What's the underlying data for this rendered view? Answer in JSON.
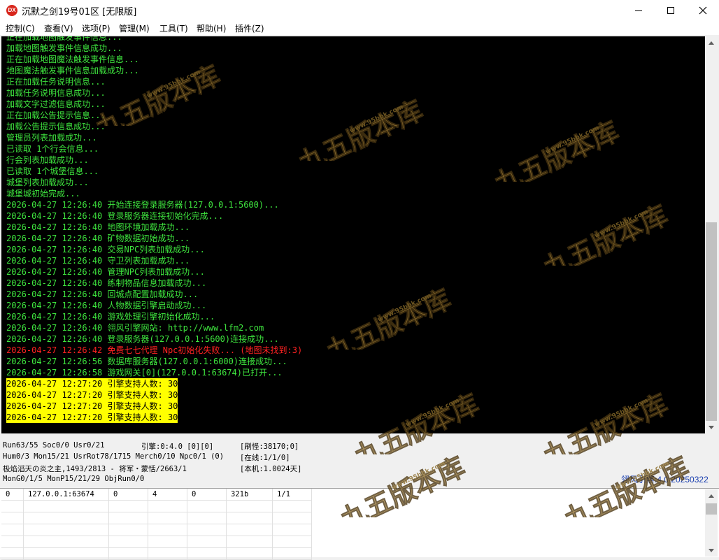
{
  "window": {
    "icon_text": "DX",
    "title": "沉默之剑19号01区 [无限版]"
  },
  "menu": [
    "控制(C)",
    "查看(V)",
    "选项(P)",
    "管理(M)",
    "工具(T)",
    "帮助(H)",
    "插件(Z)"
  ],
  "console_lines": [
    {
      "text": "正在加载地图触发事件信息...",
      "style": "g"
    },
    {
      "text": "加载地图触发事件信息成功...",
      "style": "g"
    },
    {
      "text": "正在加载地图魔法触发事件信息...",
      "style": "g"
    },
    {
      "text": "地图魔法触发事件信息加载成功...",
      "style": "g"
    },
    {
      "text": "正在加载任务说明信息...",
      "style": "g"
    },
    {
      "text": "加载任务说明信息成功...",
      "style": "g"
    },
    {
      "text": "加载文字过滤信息成功...",
      "style": "g"
    },
    {
      "text": "正在加载公告提示信息...",
      "style": "g"
    },
    {
      "text": "加载公告提示信息成功...",
      "style": "g"
    },
    {
      "text": "管理员列表加载成功...",
      "style": "g"
    },
    {
      "text": "已读取 1个行会信息...",
      "style": "g"
    },
    {
      "text": "行会列表加载成功...",
      "style": "g"
    },
    {
      "text": "已读取 1个城堡信息...",
      "style": "g"
    },
    {
      "text": "城堡列表加载成功...",
      "style": "g"
    },
    {
      "text": "城堡城初始完成...",
      "style": "g"
    },
    {
      "text": "2026-04-27 12:26:40 开始连接登录服务器(127.0.0.1:5600)...",
      "style": "g"
    },
    {
      "text": "2026-04-27 12:26:40 登录服务器连接初始化完成...",
      "style": "g"
    },
    {
      "text": "2026-04-27 12:26:40 地图环境加载成功...",
      "style": "g"
    },
    {
      "text": "2026-04-27 12:26:40 矿物数据初始成功...",
      "style": "g"
    },
    {
      "text": "2026-04-27 12:26:40 交易NPC列表加载成功...",
      "style": "g"
    },
    {
      "text": "2026-04-27 12:26:40 守卫列表加载成功...",
      "style": "g"
    },
    {
      "text": "2026-04-27 12:26:40 管理NPC列表加载成功...",
      "style": "g"
    },
    {
      "text": "2026-04-27 12:26:40 练制物品信息加载成功...",
      "style": "g"
    },
    {
      "text": "2026-04-27 12:26:40 回城点配置加载成功...",
      "style": "g"
    },
    {
      "text": "2026-04-27 12:26:40 人物数据引擎启动成功...",
      "style": "g"
    },
    {
      "text": "2026-04-27 12:26:40 游戏处理引擎初始化成功...",
      "style": "g"
    },
    {
      "text": "2026-04-27 12:26:40 翎风引擎网站: http://www.lfm2.com",
      "style": "g"
    },
    {
      "text": "2026-04-27 12:26:40 登录服务器(127.0.0.1:5600)连接成功...",
      "style": "g"
    },
    {
      "text": "2026-04-27 12:26:42 免费七七代理 Npc初始化失败... (地图未找到:3)",
      "style": "r"
    },
    {
      "text": "2026-04-27 12:26:56 数据库服务器(127.0.0.1:6000)连接成功...",
      "style": "g"
    },
    {
      "text": "2026-04-27 12:26:58 游戏网关[0](127.0.0.1:63674)已打开...",
      "style": "g"
    },
    {
      "text": "2026-04-27 12:27:20 引擎支持人数: 30",
      "style": "y"
    },
    {
      "text": "2026-04-27 12:27:20 引擎支持人数: 30",
      "style": "y"
    },
    {
      "text": "2026-04-27 12:27:20 引擎支持人数: 30",
      "style": "y"
    },
    {
      "text": "2026-04-27 12:27:20 引擎支持人数: 30",
      "style": "y"
    }
  ],
  "status": {
    "run": "Run63/55 Soc0/0 Usr0/21",
    "engine_state": "引擎:0:4.0 [0][0]",
    "refresh_monster": "[刷怪:38170;0]",
    "hum": "Hum0/3 Mon15/21 UsrRot78/1715 Merch0/10 Npc0/1 (0)",
    "online": "[在线:1/1/0]",
    "boss": "极焰滔天の炎之主,1493/2813 - 将军・蒙恬/2663/1",
    "local": "[本机:1.0024天]",
    "mon": "MonG0/1/5 MonP15/21/29 ObjRun0/0",
    "engine_version": "翎风引擎:4.0 20250322"
  },
  "grid": {
    "rows": [
      [
        "0",
        "127.0.0.1:63674",
        "0",
        "4",
        "0",
        "321b",
        "1/1"
      ]
    ],
    "empty_rows": 5
  },
  "watermark": {
    "title": "九五版本库",
    "url": "www.95bbk.com"
  }
}
